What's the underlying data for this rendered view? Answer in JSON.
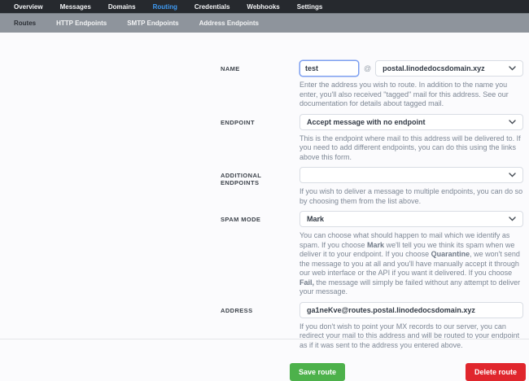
{
  "nav": {
    "items": [
      {
        "label": "Overview",
        "active": false
      },
      {
        "label": "Messages",
        "active": false
      },
      {
        "label": "Domains",
        "active": false
      },
      {
        "label": "Routing",
        "active": true
      },
      {
        "label": "Credentials",
        "active": false
      },
      {
        "label": "Webhooks",
        "active": false
      },
      {
        "label": "Settings",
        "active": false
      }
    ]
  },
  "subnav": {
    "items": [
      {
        "label": "Routes",
        "active": true
      },
      {
        "label": "HTTP Endpoints",
        "active": false
      },
      {
        "label": "SMTP Endpoints",
        "active": false
      },
      {
        "label": "Address Endpoints",
        "active": false
      }
    ]
  },
  "form": {
    "name": {
      "label": "NAME",
      "value": "test",
      "at_sign": "@",
      "domain": "postal.linodedocsdomain.xyz",
      "help": "Enter the address you wish to route. In addition to the name you enter, you'll also received \"tagged\" mail for this address. See our documentation for details about tagged mail."
    },
    "endpoint": {
      "label": "ENDPOINT",
      "value": "Accept message with no endpoint",
      "help": "This is the endpoint where mail to this address will be delivered to. If you need to add different endpoints, you can do this using the links above this form."
    },
    "additional_endpoints": {
      "label": "ADDITIONAL ENDPOINTS",
      "value": "",
      "help": "If you wish to deliver a message to multiple endpoints, you can do so by choosing them from the list above."
    },
    "spam_mode": {
      "label": "SPAM MODE",
      "value": "Mark",
      "help_segments": [
        {
          "text": "You can choose what should happen to mail which we identify as spam. If you choose "
        },
        {
          "text": "Mark",
          "bold": true
        },
        {
          "text": " we'll tell you we think its spam when we deliver it to your endpoint. If you choose "
        },
        {
          "text": "Quarantine",
          "bold": true
        },
        {
          "text": ", we won't send the message to you at all and you'll have manually accept it through our web interface or the API if you want it delivered. If you choose "
        },
        {
          "text": "Fail,",
          "bold": true
        },
        {
          "text": " the message will simply be failed without any attempt to deliver your message."
        }
      ]
    },
    "address": {
      "label": "ADDRESS",
      "value": "ga1neKve@routes.postal.linodedocsdomain.xyz",
      "help": "If you don't wish to point your MX records to our server, you can redirect your mail to this address and will be routed to your endpoint as if it was sent to the address you entered above."
    }
  },
  "buttons": {
    "save": "Save route",
    "delete": "Delete route"
  },
  "colors": {
    "topnav_bg": "#26292e",
    "nav_active": "#3f9bf4",
    "subnav_bg": "#8e949c",
    "save_green": "#4db14b",
    "delete_red": "#e0262d"
  }
}
